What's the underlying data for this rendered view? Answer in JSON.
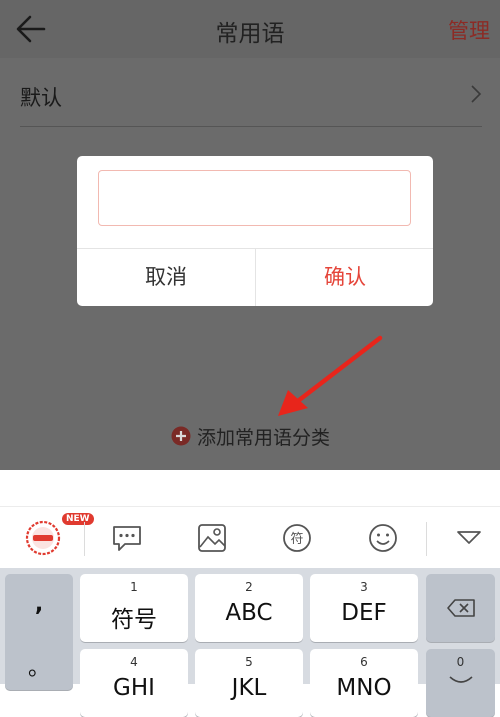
{
  "header": {
    "title": "常用语",
    "manage_label": "管理"
  },
  "list": {
    "items": [
      {
        "label": "默认"
      }
    ]
  },
  "dialog": {
    "input_value": "",
    "cancel_label": "取消",
    "confirm_label": "确认"
  },
  "add_category": {
    "label": "添加常用语分类"
  },
  "toolbar": {
    "badge": "NEW"
  },
  "keyboard": {
    "side_keys": [
      ",",
      "。"
    ],
    "keys": [
      {
        "num": "1",
        "label": "符号"
      },
      {
        "num": "2",
        "label": "ABC"
      },
      {
        "num": "3",
        "label": "DEF"
      },
      {
        "num": "4",
        "label": "GHI"
      },
      {
        "num": "5",
        "label": "JKL"
      },
      {
        "num": "6",
        "label": "MNO"
      }
    ],
    "right_key_num": "0"
  },
  "colors": {
    "accent": "#e5453a",
    "arrow": "#e8251b",
    "dim_bg": "#6b6b6b"
  }
}
